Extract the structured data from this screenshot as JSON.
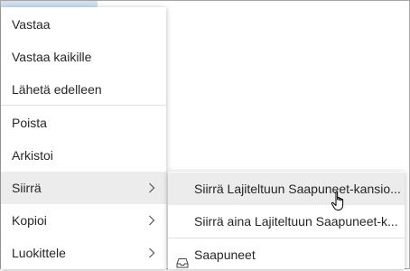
{
  "main_menu": {
    "items": [
      {
        "label": "Vastaa"
      },
      {
        "label": "Vastaa kaikille"
      },
      {
        "label": "Lähetä edelleen"
      },
      {
        "label": "Poista"
      },
      {
        "label": "Arkistoi"
      },
      {
        "label": "Siirrä"
      },
      {
        "label": "Kopioi"
      },
      {
        "label": "Luokittele"
      }
    ]
  },
  "submenu": {
    "items": [
      {
        "label": "Siirrä Lajiteltuun Saapuneet-kansio..."
      },
      {
        "label": "Siirrä aina Lajiteltuun Saapuneet-k..."
      },
      {
        "label": "Saapuneet"
      }
    ]
  },
  "colors": {
    "hover_background": "#ececec",
    "selected_strip": "#cfe0f3",
    "border": "#a6a6a6"
  },
  "icons": {
    "chevron": "chevron-right-icon",
    "inbox": "inbox-tray-icon",
    "cursor": "hand-pointer-cursor"
  }
}
